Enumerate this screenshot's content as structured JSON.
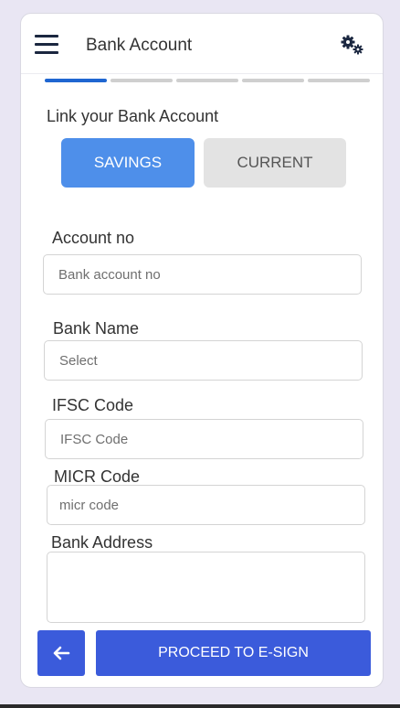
{
  "header": {
    "title": "Bank Account",
    "menu_icon": "hamburger-menu-icon",
    "settings_icon": "gears-icon"
  },
  "stepper": {
    "total_steps": 5,
    "active_step": 1
  },
  "section": {
    "title": "Link your Bank Account"
  },
  "account_type": {
    "options": [
      "SAVINGS",
      "CURRENT"
    ],
    "selected": "SAVINGS"
  },
  "form": {
    "account_no": {
      "label": "Account no",
      "placeholder": "Bank account no",
      "value": ""
    },
    "bank_name": {
      "label": "Bank Name",
      "placeholder": "Select",
      "value": ""
    },
    "ifsc": {
      "label": "IFSC Code",
      "placeholder": "IFSC Code",
      "value": ""
    },
    "micr": {
      "label": "MICR Code",
      "placeholder": "micr code",
      "value": ""
    },
    "address": {
      "label": "Bank Address",
      "value": ""
    }
  },
  "footer": {
    "back_icon": "arrow-left-icon",
    "proceed_label": "PROCEED TO E-SIGN"
  },
  "colors": {
    "primary": "#3b5bdb",
    "savings_selected": "#4e8fea",
    "unselected": "#e3e3e3",
    "step_active": "#1f66d1",
    "step_inactive": "#cfcfcf"
  }
}
